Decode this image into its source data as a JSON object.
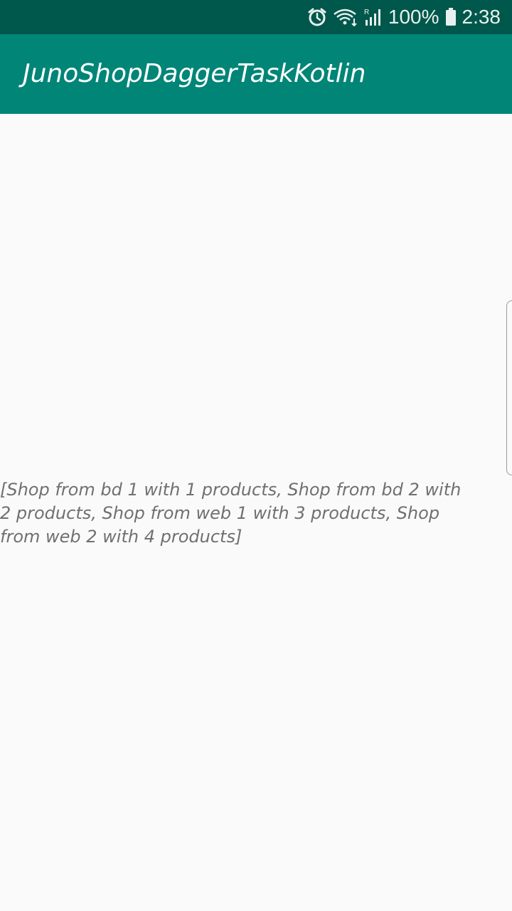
{
  "status_bar": {
    "icons": [
      "alarm-icon",
      "wifi-icon",
      "signal-icon",
      "battery-icon"
    ],
    "battery_text": "100%",
    "time": "2:38",
    "background": "#00574b"
  },
  "app_bar": {
    "title": "JunoShopDaggerTaskKotlin",
    "background": "#008577"
  },
  "main": {
    "shops_text": "[Shop from bd 1 with 1 products, Shop from bd 2 with 2 products, Shop from web 1 with 3 products, Shop from web 2 with 4 products]"
  }
}
